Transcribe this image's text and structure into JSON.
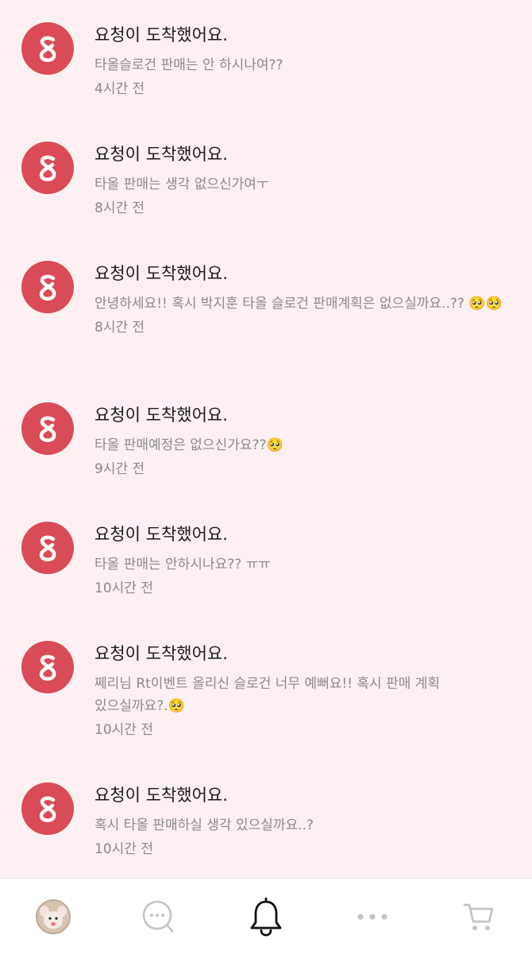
{
  "notifications": [
    {
      "title": "요청이 도착했어요.",
      "message": "타올슬로건 판매는 안 하시나여??",
      "time": "4시간 전"
    },
    {
      "title": "요청이 도착했어요.",
      "message": "타올 판매는 생각 없으신가여ㅜ",
      "time": "8시간 전"
    },
    {
      "title": "요청이 도착했어요.",
      "message": "안녕하세요!! 혹시 박지훈 타올 슬로건 판매계획은 없으실까요..?? 🥺🥺",
      "time": "8시간 전"
    },
    {
      "title": "요청이 도착했어요.",
      "message": "타올 판매예정은 없으신가요??🥺",
      "time": "9시간 전"
    },
    {
      "title": "요청이 도착했어요.",
      "message": "타올 판매는 안하시나요?? ㅠㅠ",
      "time": "10시간 전"
    },
    {
      "title": "요청이 도착했어요.",
      "message": "쩨리님 Rt이벤트 올리신 슬로건 너무 예뻐요!! 혹시 판매 계획 있으실까요?.🥺",
      "time": "10시간 전"
    },
    {
      "title": "요청이 도착했어요.",
      "message": "혹시 타올 판매하실 생각 있으실까요..?",
      "time": "10시간 전"
    }
  ],
  "icons": {
    "app_logo": "app-logo-icon",
    "tab_profile": "profile-avatar",
    "tab_chat": "chat-bubble-icon",
    "tab_notifications": "bell-icon",
    "tab_more": "more-dots-icon",
    "tab_cart": "cart-icon"
  },
  "colors": {
    "background": "#fcf0f2",
    "avatar": "#d94b57",
    "title_text": "#1a1a1a",
    "secondary_text": "#8a8a8a",
    "tab_active": "#111111",
    "tab_inactive": "#c4c4c4"
  }
}
